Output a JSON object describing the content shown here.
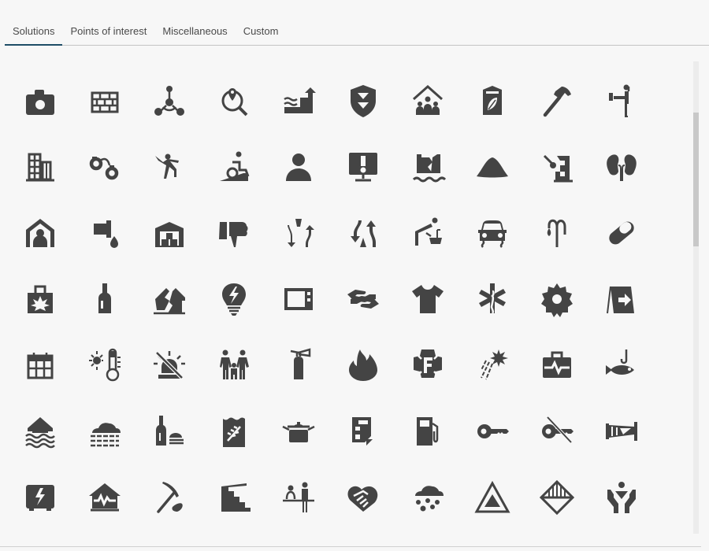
{
  "tabs": [
    {
      "label": "Solutions",
      "active": true
    },
    {
      "label": "Points of interest",
      "active": false
    },
    {
      "label": "Miscellaneous",
      "active": false
    },
    {
      "label": "Custom",
      "active": false
    }
  ],
  "colors": {
    "icon": "#444444",
    "accent": "#1e4d66",
    "background": "#f7f7f7"
  },
  "icons": [
    "camera",
    "brick-wall",
    "biohazard-network",
    "location-search",
    "coastal-flood-rise",
    "shield-down",
    "community-house",
    "recycling-bin-leaf",
    "hammer",
    "traffic-officer",
    "buildings",
    "handcuffs",
    "fall-hazard",
    "wheelchair-ramp",
    "person",
    "alert-monitor",
    "dam-break",
    "sand-pile",
    "demolition",
    "kidneys",
    "home-shelter",
    "drip-leak",
    "warehouse",
    "thumbs-down",
    "merge-split",
    "lane-merge",
    "drinking-fountain",
    "car-skid",
    "street-lamp",
    "pill",
    "cannabis-bag",
    "bottle",
    "broken-house",
    "broken-bulb",
    "microwave",
    "helping-hands",
    "t-shirt",
    "star-of-life",
    "gear",
    "exit-sign",
    "calendar",
    "heat-thermometer",
    "siren-off",
    "family",
    "fire-extinguisher",
    "fire",
    "fire-department",
    "meteor",
    "medical-kit",
    "fishing",
    "flood-house",
    "fog-cloud",
    "food-drink",
    "grain-bag",
    "cooking-pot",
    "form",
    "fuel-pump",
    "key",
    "key-off",
    "windsock",
    "electrical-box",
    "earthquake-house",
    "pickaxe",
    "staircase",
    "reception-desk",
    "heart-handshake",
    "hail",
    "warning-triangle",
    "hazard-diamond",
    "care-person"
  ]
}
